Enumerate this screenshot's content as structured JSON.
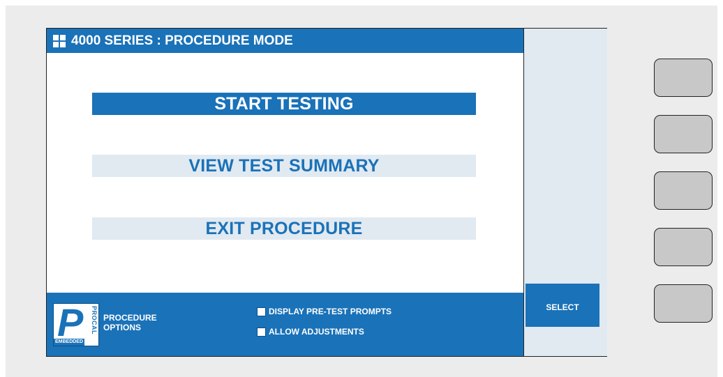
{
  "title_bar": {
    "title": "4000 SERIES : PROCEDURE MODE"
  },
  "menu": {
    "items": [
      {
        "label": "START TESTING",
        "state": "selected"
      },
      {
        "label": "VIEW TEST SUMMARY",
        "state": "unselected"
      },
      {
        "label": "EXIT PROCEDURE",
        "state": "unselected"
      }
    ]
  },
  "bottom_bar": {
    "logo": {
      "procal_text": "PROCAL",
      "embedded_text": "EMBEDDED"
    },
    "procedure_options_label": "PROCEDURE OPTIONS",
    "options": [
      {
        "label": "DISPLAY PRE-TEST PROMPTS",
        "checked": false
      },
      {
        "label": "ALLOW ADJUSTMENTS",
        "checked": false
      }
    ]
  },
  "side": {
    "select_label": "SELECT"
  },
  "hardware_keys": {
    "count": 5
  },
  "colors": {
    "accent": "#1a72b8",
    "light_panel": "#e1e9f1",
    "key_gray": "#c8c8c8"
  }
}
